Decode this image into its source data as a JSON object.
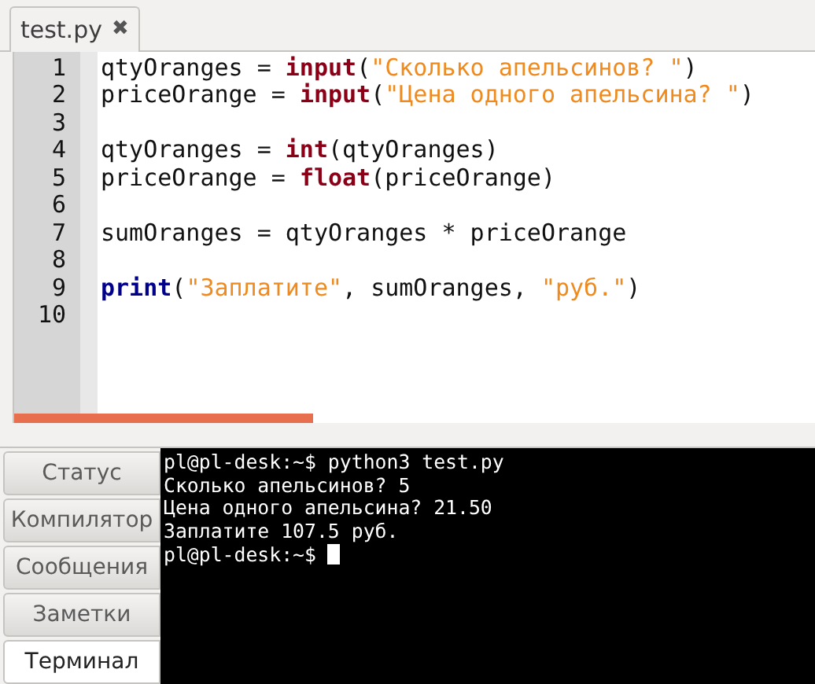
{
  "editor_tabs": [
    {
      "label": "test.py",
      "close_icon": "✖",
      "selected": true
    }
  ],
  "code": [
    {
      "number": "1",
      "tokens": [
        {
          "kind": "plain",
          "text": "qtyOranges = "
        },
        {
          "kind": "keyword",
          "text": "input"
        },
        {
          "kind": "plain",
          "text": "("
        },
        {
          "kind": "string",
          "text": "\"Сколько апельсинов? \""
        },
        {
          "kind": "plain",
          "text": ")"
        }
      ]
    },
    {
      "number": "2",
      "tokens": [
        {
          "kind": "plain",
          "text": "priceOrange = "
        },
        {
          "kind": "keyword",
          "text": "input"
        },
        {
          "kind": "plain",
          "text": "("
        },
        {
          "kind": "string",
          "text": "\"Цена одного апельсина? \""
        },
        {
          "kind": "plain",
          "text": ")"
        }
      ]
    },
    {
      "number": "3"
    },
    {
      "number": "4",
      "tokens": [
        {
          "kind": "plain",
          "text": "qtyOranges = "
        },
        {
          "kind": "keyword",
          "text": "int"
        },
        {
          "kind": "plain",
          "text": "(qtyOranges)"
        }
      ]
    },
    {
      "number": "5",
      "tokens": [
        {
          "kind": "plain",
          "text": "priceOrange = "
        },
        {
          "kind": "keyword",
          "text": "float"
        },
        {
          "kind": "plain",
          "text": "(priceOrange)"
        }
      ]
    },
    {
      "number": "6"
    },
    {
      "number": "7",
      "tokens": [
        {
          "kind": "plain",
          "text": "sumOranges = qtyOranges * priceOrange"
        }
      ]
    },
    {
      "number": "8"
    },
    {
      "number": "9",
      "tokens": [
        {
          "kind": "builtin",
          "text": "print"
        },
        {
          "kind": "plain",
          "text": "("
        },
        {
          "kind": "string",
          "text": "\"Заплатите\""
        },
        {
          "kind": "plain",
          "text": ", sumOranges, "
        },
        {
          "kind": "string",
          "text": "\"руб.\""
        },
        {
          "kind": "plain",
          "text": ")"
        }
      ]
    },
    {
      "number": "10"
    }
  ],
  "panel_tabs": [
    {
      "label": "Статус",
      "selected": false
    },
    {
      "label": "Компилятор",
      "selected": false
    },
    {
      "label": "Сообщения",
      "selected": false
    },
    {
      "label": "Заметки",
      "selected": false
    },
    {
      "label": "Терминал",
      "selected": true
    }
  ],
  "terminal": {
    "lines": [
      "pl@pl-desk:~$ python3 test.py",
      "Сколько апельсинов? 5",
      "Цена одного апельсина? 21.50",
      "Заплатите 107.5 руб.",
      "pl@pl-desk:~$ "
    ]
  }
}
